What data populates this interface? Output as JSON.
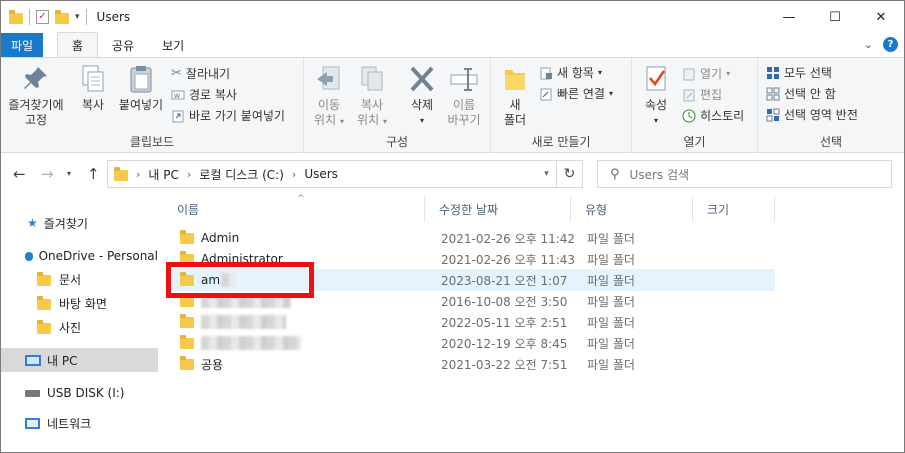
{
  "window": {
    "title": "Users",
    "minimize_glyph": "—",
    "maximize_glyph": "☐",
    "close_glyph": "✕"
  },
  "tabs": [
    {
      "label": "파일"
    },
    {
      "label": "홈"
    },
    {
      "label": "공유"
    },
    {
      "label": "보기"
    }
  ],
  "ribbon": {
    "clipboard": {
      "label": "클립보드",
      "pin_label1": "즐겨찾기에",
      "pin_label2": "고정",
      "copy_label": "복사",
      "paste_label": "붙여넣기",
      "cut_label": "잘라내기",
      "copy_path_label": "경로 복사",
      "paste_shortcut_label": "바로 가기 붙여넣기"
    },
    "organize": {
      "label": "구성",
      "move_label1": "이동",
      "move_label2": "위치",
      "copyto_label1": "복사",
      "copyto_label2": "위치",
      "delete_label": "삭제",
      "rename_label1": "이름",
      "rename_label2": "바꾸기"
    },
    "new": {
      "label": "새로 만들기",
      "folder_label1": "새",
      "folder_label2": "폴더",
      "new_item_label": "새 항목",
      "easy_access_label": "빠른 연결"
    },
    "open": {
      "label": "열기",
      "properties_label": "속성",
      "open_label": "열기",
      "edit_label": "편집",
      "history_label": "히스토리"
    },
    "select": {
      "label": "선택",
      "select_all_label": "모두 선택",
      "select_none_label": "선택 안 함",
      "invert_label": "선택 영역 반전"
    }
  },
  "address": {
    "crumbs": [
      "내 PC",
      "로컬 디스크 (C:)",
      "Users"
    ],
    "search_placeholder": "Users 검색"
  },
  "nav": {
    "quick_access": "즐겨찾기",
    "onedrive": "OneDrive - Personal",
    "documents": "문서",
    "desktop": "바탕 화면",
    "pictures": "사진",
    "this_pc": "내 PC",
    "usb": "USB DISK (I:)",
    "network": "네트워크"
  },
  "columns": {
    "name": "이름",
    "modified": "수정한 날짜",
    "type": "유형",
    "size": "크기"
  },
  "files": [
    {
      "name": "Admin",
      "modified": "2021-02-26 오후 11:42",
      "type": "파일 폴더"
    },
    {
      "name": "Administrator",
      "modified": "2021-02-26 오후 11:43",
      "type": "파일 폴더"
    },
    {
      "name": "am",
      "modified": "2023-08-21 오전 1:07",
      "type": "파일 폴더"
    },
    {
      "name": "",
      "modified": "2016-10-08 오전 3:50",
      "type": "파일 폴더"
    },
    {
      "name": "",
      "modified": "2022-05-11 오후 2:51",
      "type": "파일 폴더"
    },
    {
      "name": "",
      "modified": "2020-12-19 오후 8:45",
      "type": "파일 폴더"
    },
    {
      "name": "공용",
      "modified": "2021-03-22 오전 7:51",
      "type": "파일 폴더"
    }
  ],
  "colors": {
    "accent": "#1979ca",
    "highlight_box": "#ee1111",
    "selected_row": "#e5f3ff",
    "folder": "#f7c948"
  }
}
